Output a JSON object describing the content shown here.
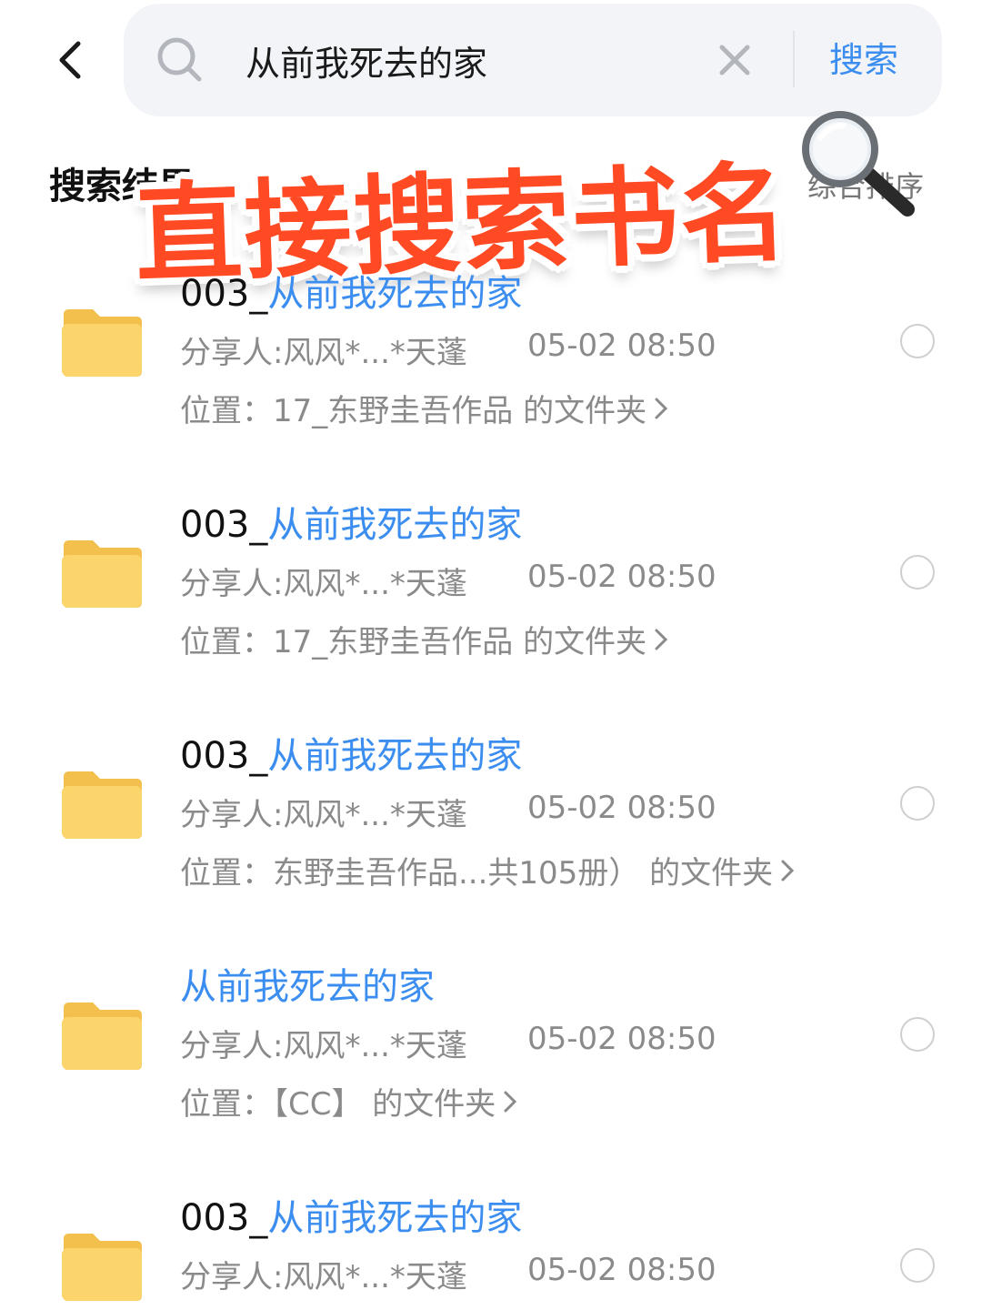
{
  "search": {
    "query": "从前我死去的家",
    "button_label": "搜索"
  },
  "results_header": {
    "title": "搜索结果",
    "sort_label": "综合排序"
  },
  "overlay": {
    "banner_text": "直接搜索书名",
    "icon": "magnifier-icon"
  },
  "results": [
    {
      "prefix": "003_",
      "highlight": "从前我死去的家",
      "sharer": "分享人:风风*...*天蓬",
      "time": "05-02 08:50",
      "location": "位置：17_东野圭吾作品 的文件夹"
    },
    {
      "prefix": "003_",
      "highlight": "从前我死去的家",
      "sharer": "分享人:风风*...*天蓬",
      "time": "05-02 08:50",
      "location": "位置：17_东野圭吾作品 的文件夹"
    },
    {
      "prefix": "003_",
      "highlight": "从前我死去的家",
      "sharer": "分享人:风风*...*天蓬",
      "time": "05-02 08:50",
      "location": "位置：东野圭吾作品...共105册） 的文件夹"
    },
    {
      "prefix": "",
      "highlight": "从前我死去的家",
      "sharer": "分享人:风风*...*天蓬",
      "time": "05-02 08:50",
      "location": "位置：【CC】 的文件夹"
    },
    {
      "prefix": "003_",
      "highlight": "从前我死去的家",
      "sharer": "分享人:风风*...*天蓬",
      "time": "05-02 08:50",
      "location": ""
    }
  ],
  "colors": {
    "accent": "#3b8ef0",
    "banner": "#ff4a24",
    "folder": "#fbd46b",
    "meta_text": "#8a8a8a"
  }
}
